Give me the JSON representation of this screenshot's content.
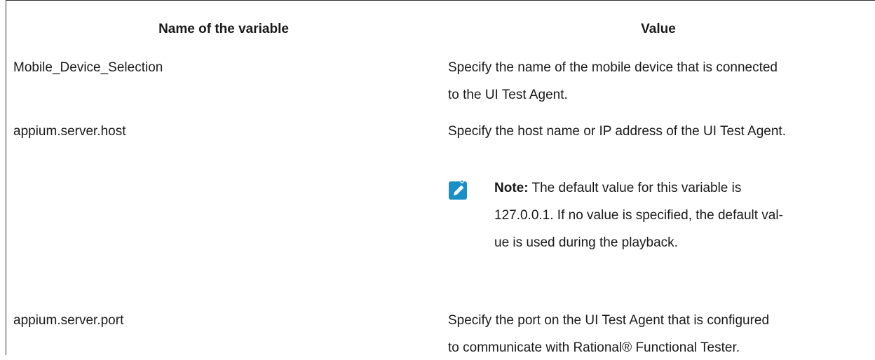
{
  "table": {
    "headers": {
      "name": "Name of the variable",
      "value": "Value"
    },
    "rows": [
      {
        "name": "Mobile_Device_Selection",
        "value_line1": "Specify the name of the mobile device that is connected",
        "value_line2": "to the UI Test Agent."
      },
      {
        "name": "appium.server.host",
        "value_line1": "Specify the host name or IP address of the UI Test Agent.",
        "note": {
          "label": "Note:",
          "line1": "The default value for this variable is",
          "line2": "127.0.0.1. If no value is specified, the default val-",
          "line3": "ue is used during the playback."
        }
      },
      {
        "name": "appium.server.port",
        "value_line1": "Specify the port on the UI Test Agent that is configured",
        "value_line2": "to communicate with Rational® Functional Tester."
      }
    ]
  },
  "colors": {
    "note_icon": "#1a8fc6",
    "border": "#333333"
  },
  "icons": {
    "note": "pencil-note-icon"
  }
}
